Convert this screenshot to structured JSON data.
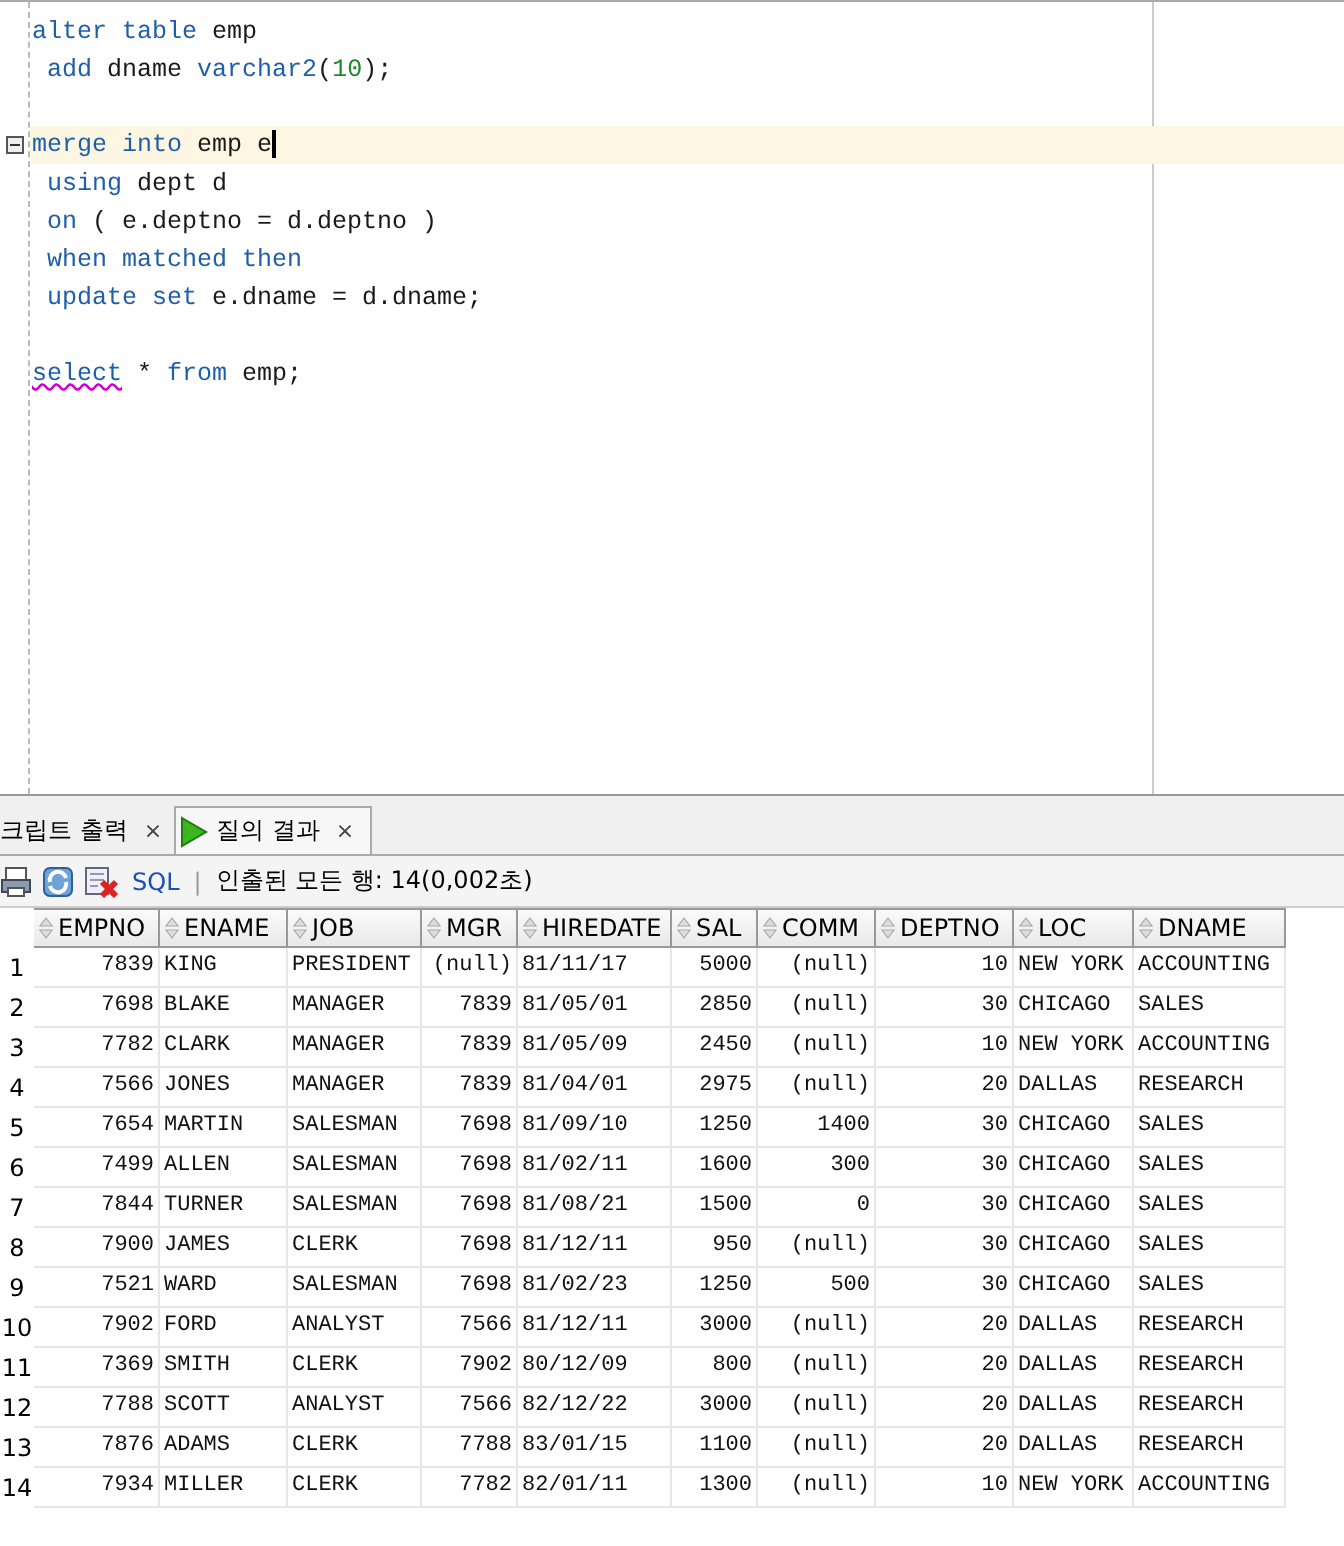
{
  "editor": {
    "lines": [
      {
        "kind": "code",
        "current": false,
        "foldable": false,
        "tokens": [
          {
            "kind": "keyword",
            "text": "alter table"
          },
          {
            "kind": "ident",
            "text": " emp"
          }
        ]
      },
      {
        "kind": "code",
        "current": false,
        "foldable": false,
        "tokens": [
          {
            "kind": "keyword",
            "text": " add"
          },
          {
            "kind": "ident",
            "text": " dname "
          },
          {
            "kind": "keyword",
            "text": "varchar2"
          },
          {
            "kind": "ident",
            "text": "("
          },
          {
            "kind": "number",
            "text": "10"
          },
          {
            "kind": "ident",
            "text": ");"
          }
        ]
      },
      {
        "kind": "blank"
      },
      {
        "kind": "code",
        "current": true,
        "foldable": true,
        "tokens": [
          {
            "kind": "keyword",
            "text": "merge into"
          },
          {
            "kind": "ident",
            "text": " emp e"
          }
        ]
      },
      {
        "kind": "code",
        "current": false,
        "foldable": false,
        "tokens": [
          {
            "kind": "keyword",
            "text": " using"
          },
          {
            "kind": "ident",
            "text": " dept d"
          }
        ]
      },
      {
        "kind": "code",
        "current": false,
        "foldable": false,
        "tokens": [
          {
            "kind": "keyword",
            "text": " on"
          },
          {
            "kind": "ident",
            "text": " ( e.deptno = d.deptno )"
          }
        ]
      },
      {
        "kind": "code",
        "current": false,
        "foldable": false,
        "tokens": [
          {
            "kind": "keyword",
            "text": " when matched then"
          }
        ]
      },
      {
        "kind": "code",
        "current": false,
        "foldable": false,
        "tokens": [
          {
            "kind": "keyword",
            "text": " update set"
          },
          {
            "kind": "ident",
            "text": " e.dname = d.dname;"
          }
        ]
      },
      {
        "kind": "blank"
      },
      {
        "kind": "code",
        "current": false,
        "foldable": false,
        "tokens": [
          {
            "kind": "error",
            "text": "select"
          },
          {
            "kind": "ident",
            "text": " * "
          },
          {
            "kind": "keyword",
            "text": "from"
          },
          {
            "kind": "ident",
            "text": " emp;"
          }
        ]
      }
    ]
  },
  "tabs": [
    {
      "label": "크립트 출력",
      "close": "×",
      "selected": false,
      "run_icon": false
    },
    {
      "label": "질의 결과",
      "close": "×",
      "selected": true,
      "run_icon": true
    }
  ],
  "toolbar": {
    "sql_link": "SQL",
    "separator": "|",
    "status": "인출된 모든 행: 14(0,002초)"
  },
  "table": {
    "columns": [
      {
        "label": "EMPNO",
        "kind": "number"
      },
      {
        "label": "ENAME",
        "kind": "text"
      },
      {
        "label": "JOB",
        "kind": "text"
      },
      {
        "label": "MGR",
        "kind": "number"
      },
      {
        "label": "HIREDATE",
        "kind": "text"
      },
      {
        "label": "SAL",
        "kind": "number"
      },
      {
        "label": "COMM",
        "kind": "number"
      },
      {
        "label": "DEPTNO",
        "kind": "number"
      },
      {
        "label": "LOC",
        "kind": "text"
      },
      {
        "label": "DNAME",
        "kind": "text"
      }
    ],
    "rows": [
      {
        "num": "1",
        "cells": [
          "7839",
          "KING",
          "PRESIDENT",
          "(null)",
          "81/11/17",
          "5000",
          "(null)",
          "10",
          "NEW YORK",
          "ACCOUNTING"
        ]
      },
      {
        "num": "2",
        "cells": [
          "7698",
          "BLAKE",
          "MANAGER",
          "7839",
          "81/05/01",
          "2850",
          "(null)",
          "30",
          "CHICAGO",
          "SALES"
        ]
      },
      {
        "num": "3",
        "cells": [
          "7782",
          "CLARK",
          "MANAGER",
          "7839",
          "81/05/09",
          "2450",
          "(null)",
          "10",
          "NEW YORK",
          "ACCOUNTING"
        ]
      },
      {
        "num": "4",
        "cells": [
          "7566",
          "JONES",
          "MANAGER",
          "7839",
          "81/04/01",
          "2975",
          "(null)",
          "20",
          "DALLAS",
          "RESEARCH"
        ]
      },
      {
        "num": "5",
        "cells": [
          "7654",
          "MARTIN",
          "SALESMAN",
          "7698",
          "81/09/10",
          "1250",
          "1400",
          "30",
          "CHICAGO",
          "SALES"
        ]
      },
      {
        "num": "6",
        "cells": [
          "7499",
          "ALLEN",
          "SALESMAN",
          "7698",
          "81/02/11",
          "1600",
          "300",
          "30",
          "CHICAGO",
          "SALES"
        ]
      },
      {
        "num": "7",
        "cells": [
          "7844",
          "TURNER",
          "SALESMAN",
          "7698",
          "81/08/21",
          "1500",
          "0",
          "30",
          "CHICAGO",
          "SALES"
        ]
      },
      {
        "num": "8",
        "cells": [
          "7900",
          "JAMES",
          "CLERK",
          "7698",
          "81/12/11",
          "950",
          "(null)",
          "30",
          "CHICAGO",
          "SALES"
        ]
      },
      {
        "num": "9",
        "cells": [
          "7521",
          "WARD",
          "SALESMAN",
          "7698",
          "81/02/23",
          "1250",
          "500",
          "30",
          "CHICAGO",
          "SALES"
        ]
      },
      {
        "num": "10",
        "cells": [
          "7902",
          "FORD",
          "ANALYST",
          "7566",
          "81/12/11",
          "3000",
          "(null)",
          "20",
          "DALLAS",
          "RESEARCH"
        ]
      },
      {
        "num": "11",
        "cells": [
          "7369",
          "SMITH",
          "CLERK",
          "7902",
          "80/12/09",
          "800",
          "(null)",
          "20",
          "DALLAS",
          "RESEARCH"
        ]
      },
      {
        "num": "12",
        "cells": [
          "7788",
          "SCOTT",
          "ANALYST",
          "7566",
          "82/12/22",
          "3000",
          "(null)",
          "20",
          "DALLAS",
          "RESEARCH"
        ]
      },
      {
        "num": "13",
        "cells": [
          "7876",
          "ADAMS",
          "CLERK",
          "7788",
          "83/01/15",
          "1100",
          "(null)",
          "20",
          "DALLAS",
          "RESEARCH"
        ]
      },
      {
        "num": "14",
        "cells": [
          "7934",
          "MILLER",
          "CLERK",
          "7782",
          "82/01/11",
          "1300",
          "(null)",
          "10",
          "NEW YORK",
          "ACCOUNTING"
        ]
      }
    ]
  }
}
